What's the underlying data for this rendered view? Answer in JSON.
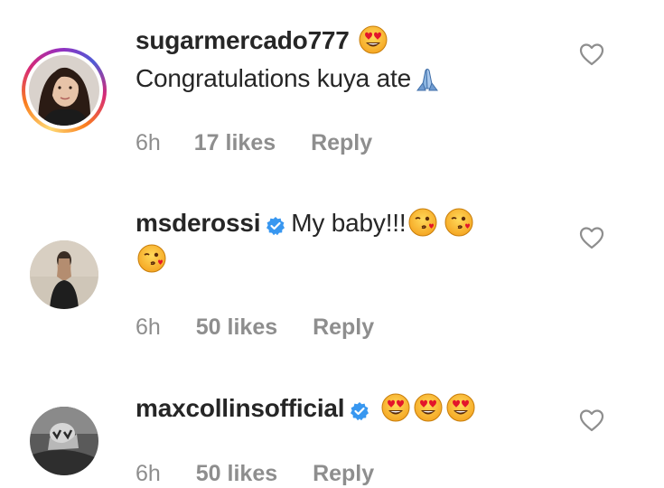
{
  "comments": [
    {
      "username": "sugarmercado777",
      "verified": false,
      "text": "Congratulations kuya ate",
      "time": "6h",
      "likes": "17 likes",
      "reply": "Reply",
      "avatar_icon": "woman-portrait",
      "story_ring": true
    },
    {
      "username": "msderossi",
      "verified": true,
      "text": "My baby!!!",
      "time": "6h",
      "likes": "50 likes",
      "reply": "Reply",
      "avatar_icon": "person-portrait"
    },
    {
      "username": "maxcollinsofficial",
      "verified": true,
      "text": "",
      "time": "6h",
      "likes": "50 likes",
      "reply": "Reply",
      "avatar_icon": "grayscale-portrait"
    }
  ],
  "icons": {
    "like": "heart-outline-icon",
    "verified": "verified-badge-icon",
    "heart_eyes": "heart-eyes-emoji",
    "blow_kiss": "face-blowing-kiss-emoji",
    "pray": "folded-hands-emoji"
  },
  "colors": {
    "verified_blue": "#3897f0",
    "meta_gray": "#8e8e8e",
    "text": "#262626"
  }
}
